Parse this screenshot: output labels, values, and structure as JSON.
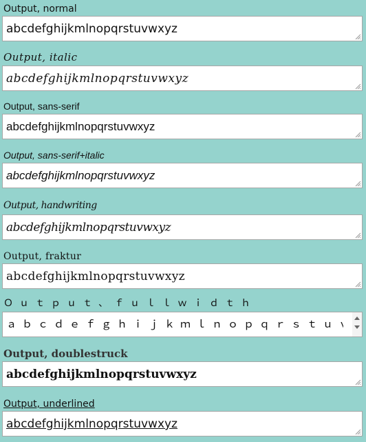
{
  "fields": [
    {
      "label": "Output, normal",
      "value": "abcdefghijkmlnopqrstuvwxyz"
    },
    {
      "label": "Output, italic",
      "value": "abcdefghijkmlnopqrstuvwxyz"
    },
    {
      "label": "Output, sans-serif",
      "value": "abcdefghijkmlnopqrstuvwxyz"
    },
    {
      "label": "Output, sans-serif+italic",
      "value": "abcdefghijkmlnopqrstuvwxyz"
    },
    {
      "label": "Output, handwriting",
      "value": "abcdefghijkmlnopqrstuvwxyz"
    },
    {
      "label": "Output, fraktur",
      "value": "abcdefghijkmlnopqrstuvwxyz"
    },
    {
      "label": "Ｏｕｔｐｕｔ、ｆｕｌｌｗｉｄｔｈ",
      "value": "ａｂｃｄｅｆｇｈｉｊｋｍｌｎｏｐｑｒｓｔｕｖｗｘｙ"
    },
    {
      "label": "Output, doublestruck",
      "value": "abcdefghijkmlnopqrstuvwxyz"
    },
    {
      "label": "Output, underlined",
      "value": "abcdefghijkmlnopqrstuvwxyz"
    }
  ],
  "icons": {
    "resize": "resize-grip-icon",
    "scroll_up": "scroll-up-arrow-icon",
    "scroll_down": "scroll-down-arrow-icon"
  },
  "colors": {
    "background": "#95d3cd",
    "field_background": "#ffffff",
    "field_border": "#a6a6a6"
  }
}
